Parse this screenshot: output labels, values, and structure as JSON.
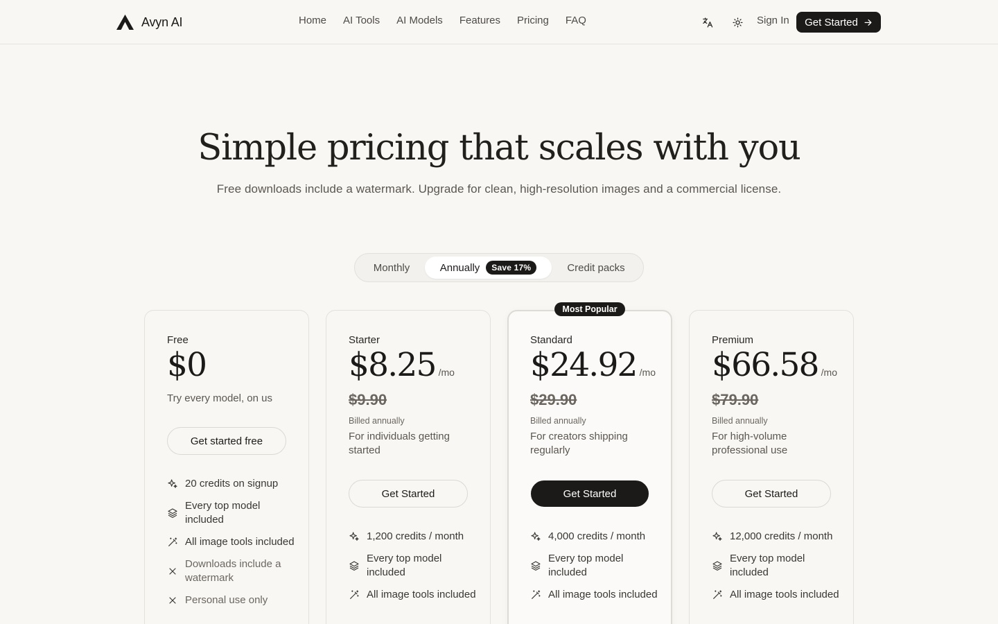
{
  "header": {
    "brand": "Avyn AI",
    "nav": [
      "Home",
      "AI Tools",
      "AI Models",
      "Features",
      "Pricing",
      "FAQ"
    ],
    "sign_in": "Sign In",
    "get_started": "Get Started",
    "icons": {
      "language": "translate-icon",
      "theme": "sun-icon",
      "cta": "arrow-right-icon",
      "logo": "avyn-logo-icon"
    }
  },
  "hero": {
    "title": "Simple pricing that scales with you",
    "subtitle": "Free downloads include a watermark. Upgrade for clean, high-resolution images and a commercial license."
  },
  "billing_toggle": {
    "options": [
      "Monthly",
      "Annually",
      "Credit packs"
    ],
    "selected": "Annually",
    "save_badge": "Save 17%"
  },
  "plans": [
    {
      "name": "Free",
      "price": "$0",
      "tagline": "Try every model, on us",
      "cta": "Get started free",
      "features": [
        {
          "text": "20 credits on signup",
          "icon": "sparkles-icon"
        },
        {
          "text": "Every top model included",
          "icon": "layers-icon"
        },
        {
          "text": "All image tools included",
          "icon": "magic-wand-icon"
        },
        {
          "text": "Downloads include a watermark",
          "icon": "x-icon"
        },
        {
          "text": "Personal use only",
          "icon": "x-icon"
        }
      ]
    },
    {
      "name": "Starter",
      "price": "$8.25",
      "per": "/mo",
      "old_price": "$9.90",
      "billed": "Billed annually",
      "tagline": "For individuals getting started",
      "cta": "Get Started",
      "features": [
        {
          "text": "1,200 credits / month",
          "icon": "sparkles-icon"
        },
        {
          "text": "Every top model included",
          "icon": "layers-icon"
        },
        {
          "text": "All image tools included",
          "icon": "magic-wand-icon"
        }
      ]
    },
    {
      "name": "Standard",
      "badge": "Most Popular",
      "price": "$24.92",
      "per": "/mo",
      "old_price": "$29.90",
      "billed": "Billed annually",
      "tagline": "For creators shipping regularly",
      "cta": "Get Started",
      "features": [
        {
          "text": "4,000 credits / month",
          "icon": "sparkles-icon"
        },
        {
          "text": "Every top model included",
          "icon": "layers-icon"
        },
        {
          "text": "All image tools included",
          "icon": "magic-wand-icon"
        }
      ]
    },
    {
      "name": "Premium",
      "price": "$66.58",
      "per": "/mo",
      "old_price": "$79.90",
      "billed": "Billed annually",
      "tagline": "For high-volume professional use",
      "cta": "Get Started",
      "features": [
        {
          "text": "12,000 credits / month",
          "icon": "sparkles-icon"
        },
        {
          "text": "Every top model included",
          "icon": "layers-icon"
        },
        {
          "text": "All image tools included",
          "icon": "magic-wand-icon"
        }
      ]
    }
  ]
}
